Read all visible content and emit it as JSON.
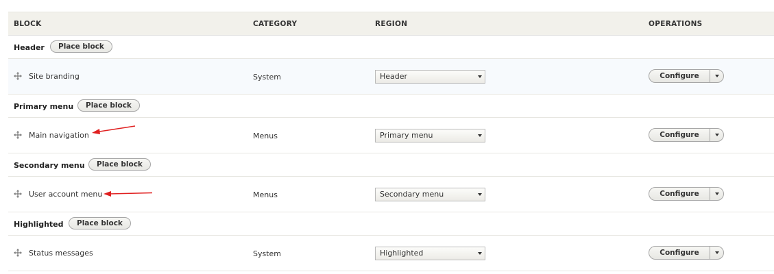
{
  "columns": {
    "block": "BLOCK",
    "category": "CATEGORY",
    "region": "REGION",
    "operations": "OPERATIONS"
  },
  "place_block_label": "Place block",
  "configure_label": "Configure",
  "regions": [
    {
      "title": "Header",
      "blocks": [
        {
          "name": "Site branding",
          "category": "System",
          "region": "Header"
        }
      ]
    },
    {
      "title": "Primary menu",
      "blocks": [
        {
          "name": "Main navigation",
          "category": "Menus",
          "region": "Primary menu"
        }
      ]
    },
    {
      "title": "Secondary menu",
      "blocks": [
        {
          "name": "User account menu",
          "category": "Menus",
          "region": "Secondary menu"
        }
      ]
    },
    {
      "title": "Highlighted",
      "blocks": [
        {
          "name": "Status messages",
          "category": "System",
          "region": "Highlighted"
        }
      ]
    }
  ],
  "colors": {
    "header_bg": "#f2f1eb",
    "highlight_row": "#f7fafd",
    "annotation_arrow": "#e02020"
  },
  "icons": {
    "drag_handle": "move-arrows-icon",
    "select_caret": "chevron-down-icon",
    "dropbutton_toggle": "chevron-down-icon"
  }
}
